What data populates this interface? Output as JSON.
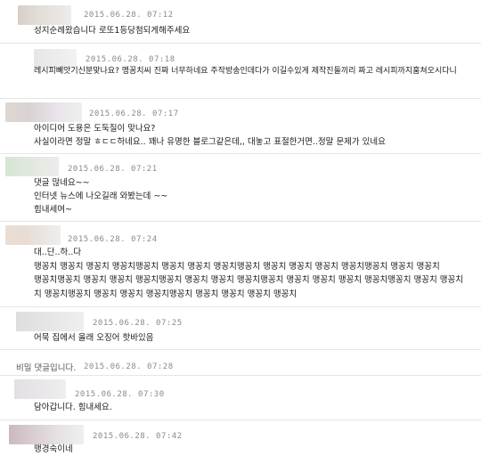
{
  "colors": {
    "separator": "#e6e6e6",
    "date": "#8a8a8a",
    "text": "#1a1a1a"
  },
  "comments": [
    {
      "date": "2015.06.28. 07:12",
      "text": "성지순례왔습니다 로또1등당첨되게해주세요"
    },
    {
      "date": "2015.06.28. 07:18",
      "text": "레시피빼앗기신분맞나요? 맹꽁치씨 진짜 너무하네요 주작방송인데다가 이길수있게 제작진들끼리 짜고 레시피까지훔쳐오시다니"
    },
    {
      "date": "2015.06.28. 07:17",
      "text": "아이디어 도용은 도둑질이 맞나요?\n사실이라면 정말 ㅎㄷㄷ하네요.. 꽤나 유명한 블로그같은데,, 대놓고 표절한거면..정말 문제가 있네요"
    },
    {
      "date": "2015.06.28. 07:21",
      "text": "댓글 많네요~~\n인터넷 뉴스에 나오길래 와봤는데 ~~\n힘내세여~"
    },
    {
      "date": "2015.06.28. 07:24",
      "text": "대..단..하..다\n맹꽁치 맹꽁치 맹꽁치 맹꽁치맹꽁치 맹꽁치 맹꽁치 맹꽁치맹꽁치 맹꽁치 맹꽁치 맹꽁치 맹꽁치맹꽁치 맹꽁치 맹꽁치\n맹꽁치맹꽁치 맹꽁치 맹꽁치 맹꽁치맹꽁치 맹꽁치 맹꽁치 맹꽁치맹꽁치 맹꽁치 맹꽁치 맹꽁치 맹꽁치맹꽁치 맹꽁치 맹꽁치\n치 맹꽁치맹꽁치 맹꽁치 맹꽁치 맹꽁치맹꽁치 맹꽁치 맹꽁치 맹꽁치 맹꽁치"
    },
    {
      "date": "2015.06.28. 07:25",
      "text": "어묵 집에서 올래 오징어 핫바있음"
    },
    {
      "secret_label": "비밀 댓글입니다.",
      "date": "2015.06.28. 07:28"
    },
    {
      "date": "2015.06.28. 07:30",
      "text": "담아갑니다. 힘내세요."
    },
    {
      "date": "2015.06.28. 07:42",
      "text": "맹경숙이네"
    }
  ]
}
